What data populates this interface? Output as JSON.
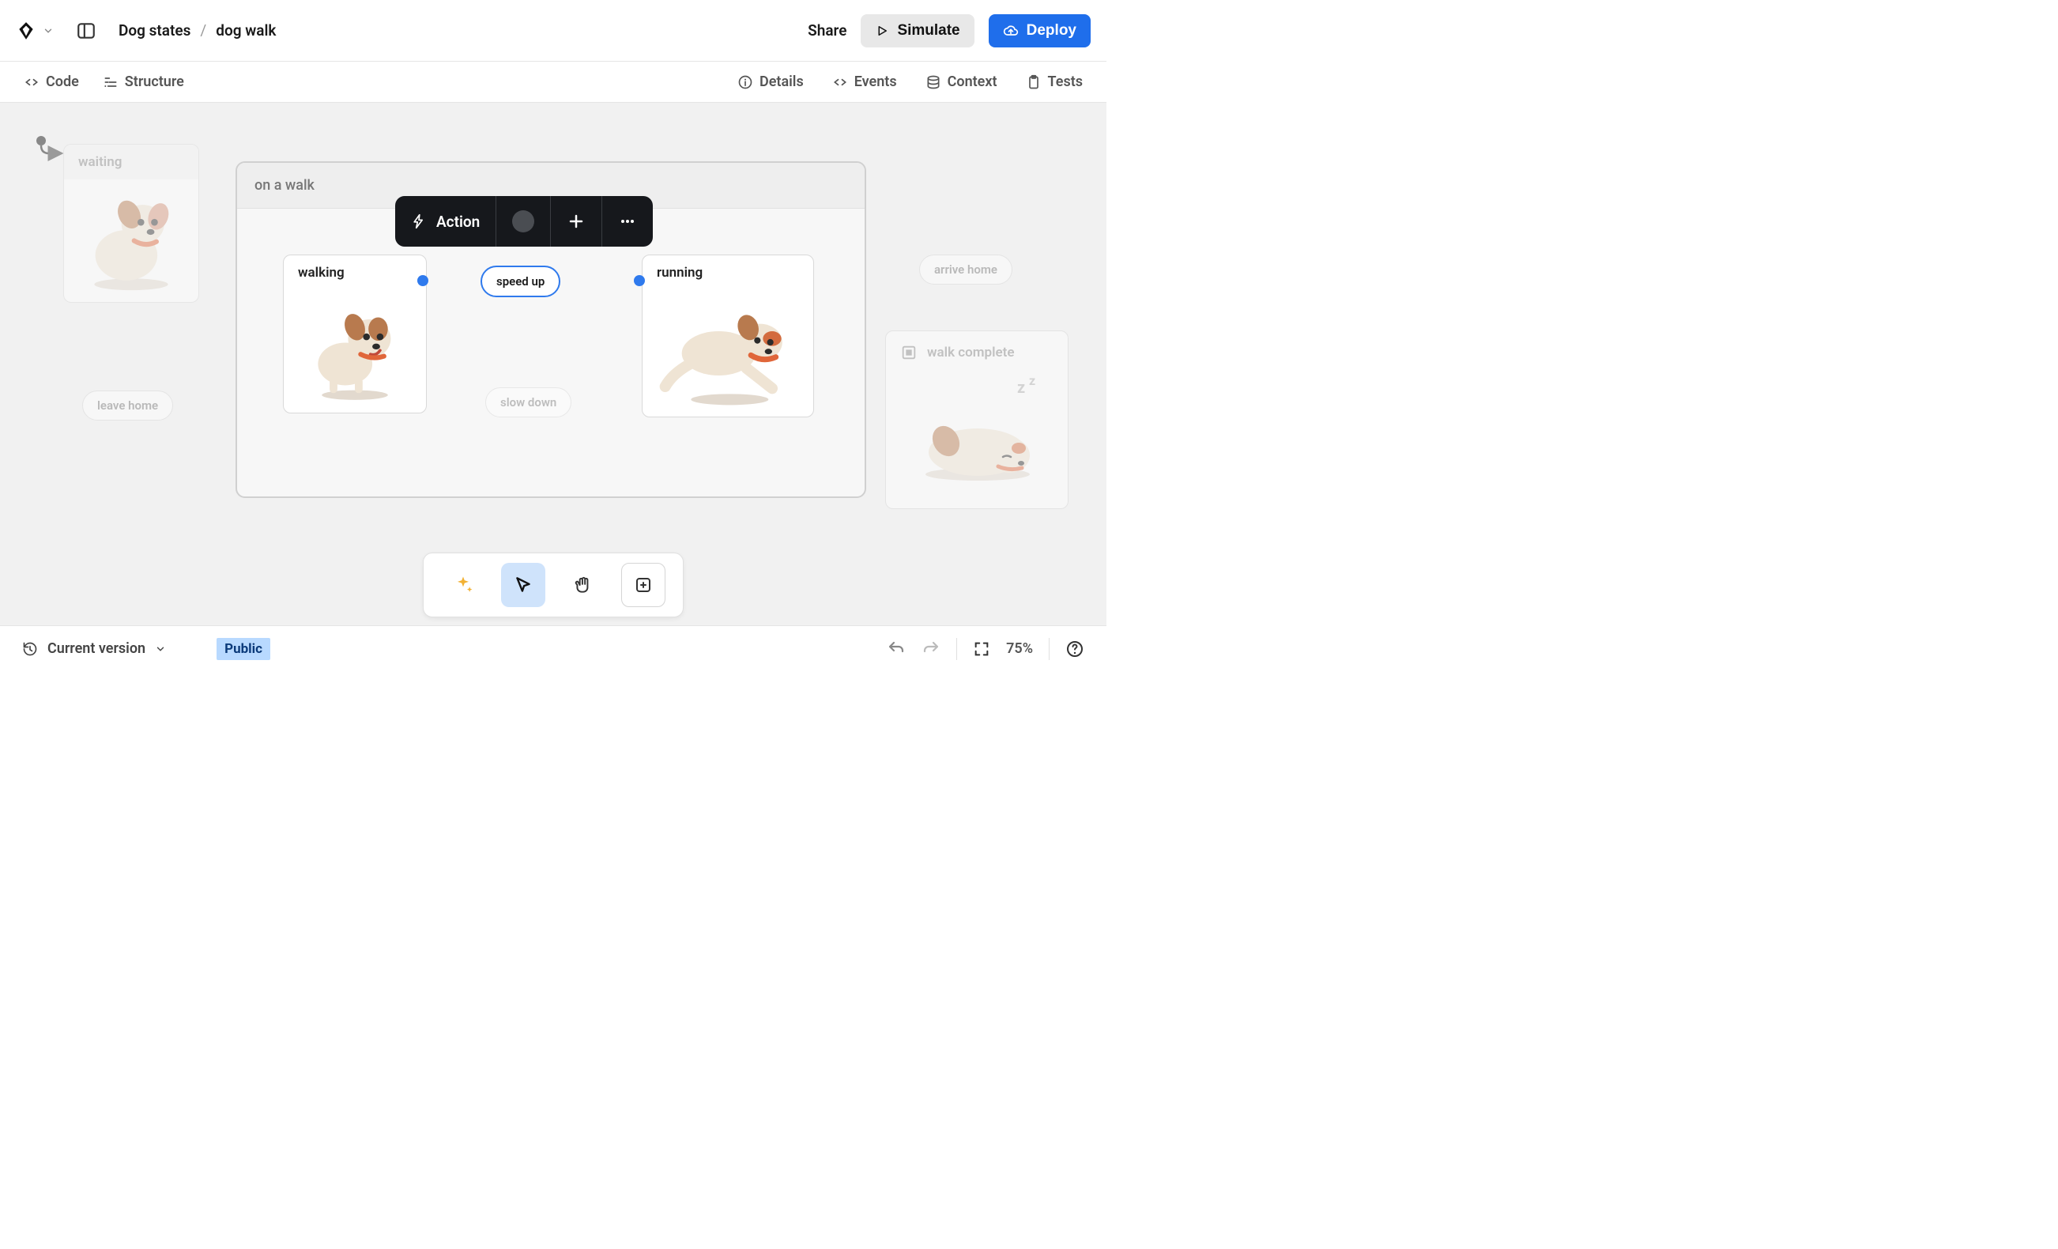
{
  "header": {
    "project_name": "Dog states",
    "current_file": "dog walk",
    "share_label": "Share",
    "simulate_label": "Simulate",
    "deploy_label": "Deploy"
  },
  "tabs": {
    "code": "Code",
    "structure": "Structure",
    "details": "Details",
    "events": "Events",
    "context": "Context",
    "tests": "Tests"
  },
  "canvas": {
    "compound_state": "on a walk",
    "states": {
      "waiting": "waiting",
      "walking": "walking",
      "running": "running",
      "walk_complete": "walk complete"
    },
    "transitions": {
      "leave_home": "leave home",
      "speed_up": "speed up",
      "slow_down": "slow down",
      "arrive_home": "arrive home"
    },
    "action_toolbar": {
      "action_label": "Action"
    }
  },
  "statusbar": {
    "version_label": "Current version",
    "visibility_badge": "Public",
    "zoom": "75%"
  }
}
